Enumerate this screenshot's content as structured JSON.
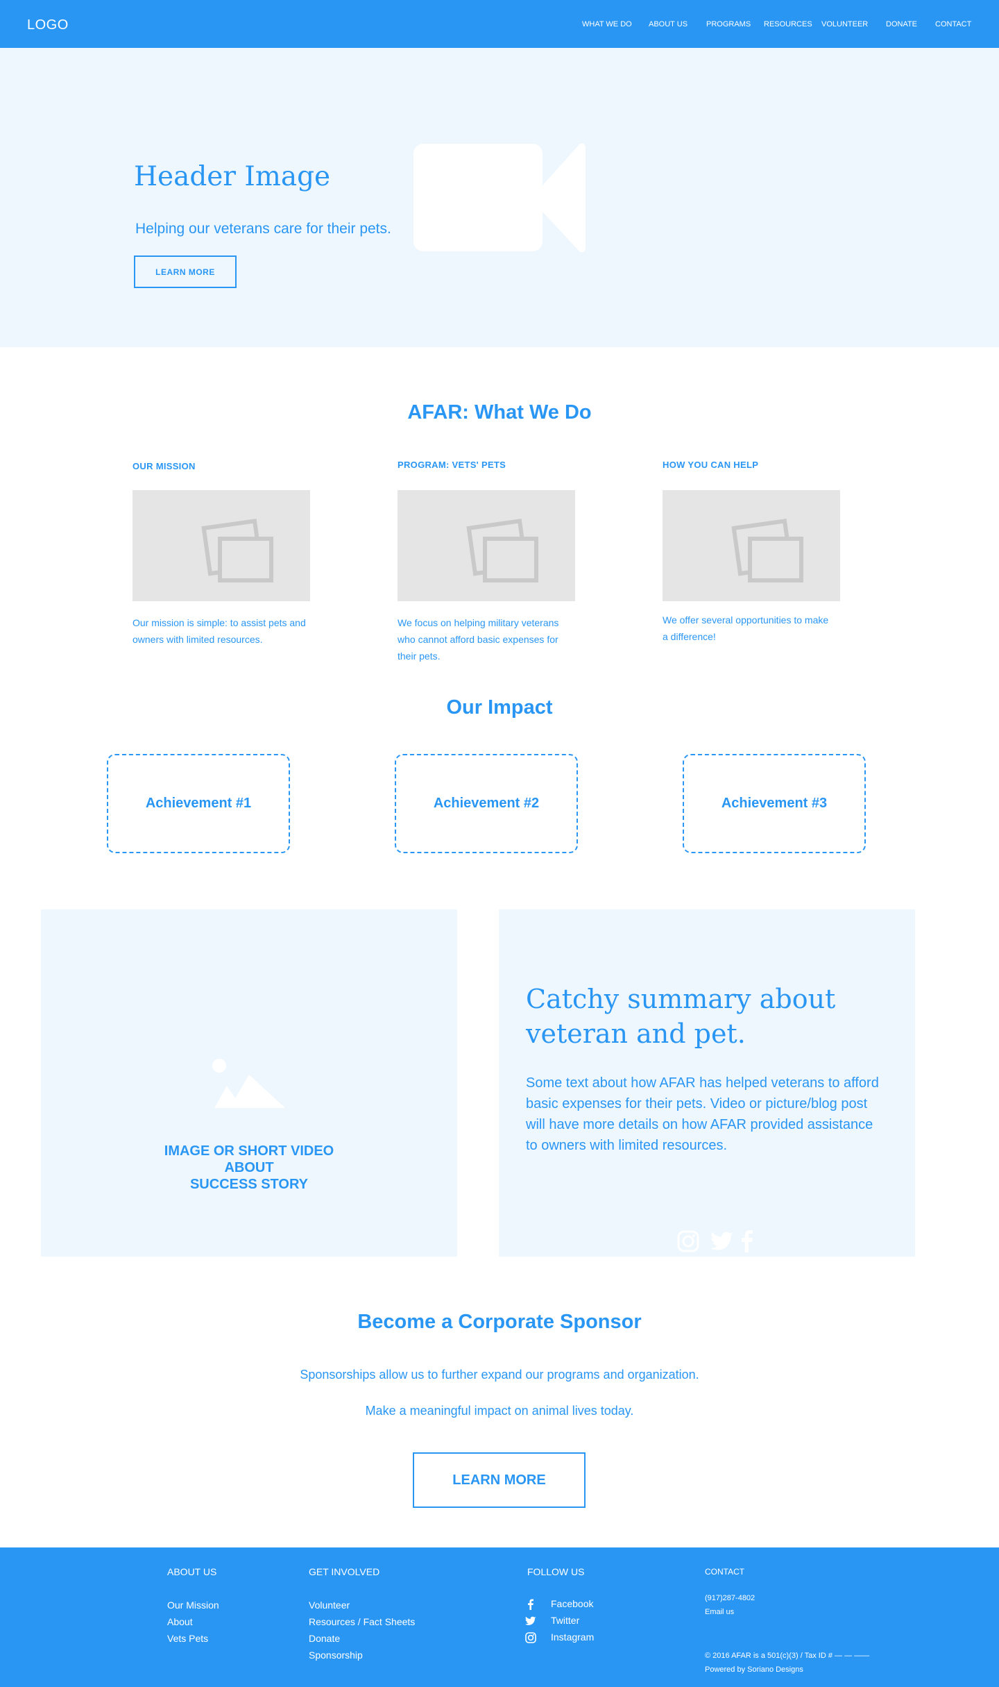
{
  "nav": {
    "logo": "LOGO",
    "items": [
      "WHAT WE DO",
      "ABOUT US",
      "PROGRAMS",
      "RESOURCES",
      "VOLUNTEER",
      "DONATE",
      "CONTACT"
    ]
  },
  "hero": {
    "title": "Header Image",
    "subtitle": "Helping our veterans care for their pets.",
    "button": "LEARN MORE",
    "media_icon": "video-camera-icon"
  },
  "what_we_do": {
    "title": "AFAR: What We Do",
    "columns": [
      {
        "heading": "OUR MISSION",
        "icon": "image-placeholder-icon",
        "text": "Our mission is simple: to assist pets and owners with limited resources."
      },
      {
        "heading": "PROGRAM: VETS' PETS",
        "icon": "image-placeholder-icon",
        "text": "We focus on helping military veterans who cannot afford basic expenses for their pets."
      },
      {
        "heading": "HOW YOU CAN HELP",
        "icon": "image-placeholder-icon",
        "text": "We offer several opportunities to make a difference!"
      }
    ]
  },
  "impact": {
    "title": "Our Impact",
    "achievements": [
      "Achievement #1",
      "Achievement #2",
      "Achievement #3"
    ]
  },
  "story": {
    "caption_lines": [
      "IMAGE OR SHORT VIDEO",
      "ABOUT",
      "SUCCESS STORY"
    ],
    "media_icon": "landscape-image-icon",
    "headline": "Catchy summary about veteran and pet.",
    "body": "Some text about how AFAR has helped veterans to afford basic expenses for their pets. Video or picture/blog post will have more details on how AFAR provided assistance to owners with limited resources.",
    "social_icons": [
      "instagram-icon",
      "twitter-icon",
      "facebook-icon"
    ]
  },
  "sponsor": {
    "title": "Become a Corporate Sponsor",
    "line1": "Sponsorships allow us to further expand our programs and organization.",
    "line2": "Make a meaningful impact on animal lives today.",
    "button": "LEARN MORE"
  },
  "footer": {
    "about": {
      "heading": "ABOUT US",
      "links": [
        "Our Mission",
        "About",
        "Vets Pets"
      ]
    },
    "involved": {
      "heading": "GET INVOLVED",
      "links": [
        "Volunteer",
        "Resources / Fact Sheets",
        "Donate",
        "Sponsorship"
      ]
    },
    "follow": {
      "heading": "FOLLOW US",
      "links": [
        "Facebook",
        "Twitter",
        "Instagram"
      ]
    },
    "contact": {
      "heading": "CONTACT",
      "phone": "(917)287-4802",
      "email": "Email us",
      "legal": "© 2016 AFAR is a 501(c)(3) / Tax ID # — — ——",
      "powered": "Powered by Soriano Designs"
    }
  },
  "colors": {
    "brand": "#2996f4",
    "tint": "#eef7fe",
    "placeholder": "#e5e5e5",
    "placeholder_stroke": "#c9c9c9"
  }
}
